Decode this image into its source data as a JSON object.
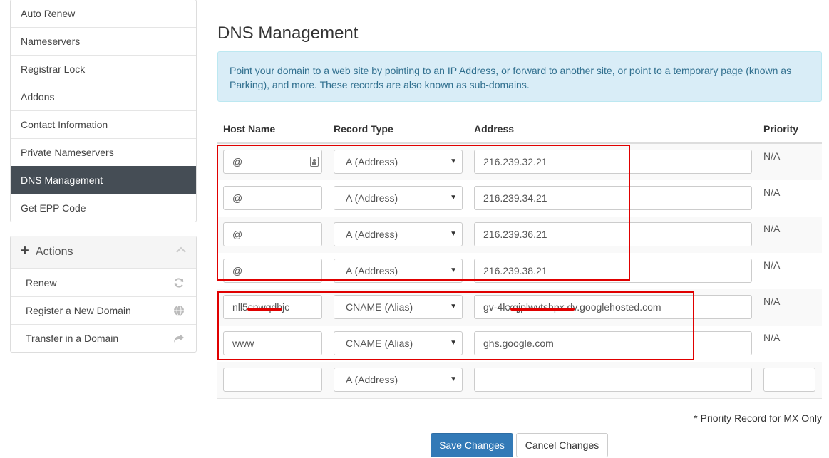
{
  "sidebar": {
    "items": [
      {
        "label": "Auto Renew"
      },
      {
        "label": "Nameservers"
      },
      {
        "label": "Registrar Lock"
      },
      {
        "label": "Addons"
      },
      {
        "label": "Contact Information"
      },
      {
        "label": "Private Nameservers"
      },
      {
        "label": "DNS Management",
        "active": true
      },
      {
        "label": "Get EPP Code"
      }
    ],
    "actions": {
      "title": "Actions",
      "items": [
        {
          "label": "Renew",
          "icon": "refresh-icon"
        },
        {
          "label": "Register a New Domain",
          "icon": "globe-icon"
        },
        {
          "label": "Transfer in a Domain",
          "icon": "share-arrow-icon"
        }
      ]
    }
  },
  "main": {
    "title": "DNS Management",
    "info": "Point your domain to a web site by pointing to an IP Address, or forward to another site, or point to a temporary page (known as Parking), and more. These records are also known as sub-domains.",
    "columns": {
      "host": "Host Name",
      "type": "Record Type",
      "address": "Address",
      "priority": "Priority"
    },
    "records": [
      {
        "host": "@",
        "type": "A (Address)",
        "address": "216.239.32.21",
        "priority": "N/A"
      },
      {
        "host": "@",
        "type": "A (Address)",
        "address": "216.239.34.21",
        "priority": "N/A"
      },
      {
        "host": "@",
        "type": "A (Address)",
        "address": "216.239.36.21",
        "priority": "N/A"
      },
      {
        "host": "@",
        "type": "A (Address)",
        "address": "216.239.38.21",
        "priority": "N/A"
      },
      {
        "host": "nll5cnwqdhjc",
        "type": "CNAME (Alias)",
        "address": "gv-4kxqjplwvtshpx.dv.googlehosted.com",
        "priority": "N/A"
      },
      {
        "host": "www",
        "type": "CNAME (Alias)",
        "address": "ghs.google.com",
        "priority": "N/A"
      }
    ],
    "new_record": {
      "host": "",
      "type": "A (Address)",
      "address": "",
      "priority": ""
    },
    "footnote": "* Priority Record for MX Only",
    "save_label": "Save Changes",
    "cancel_label": "Cancel Changes"
  },
  "colors": {
    "accent": "#337ab7",
    "active_nav": "#454d55",
    "info_bg": "#d9edf7",
    "annotation_red": "#e00000"
  }
}
